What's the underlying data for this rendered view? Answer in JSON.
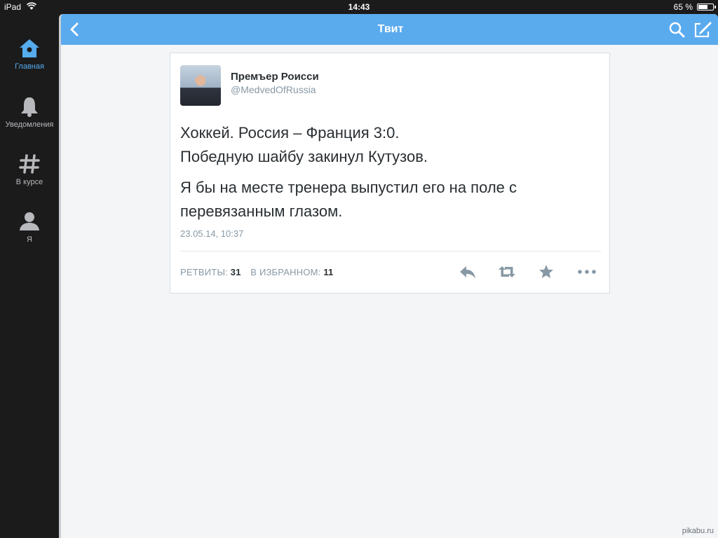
{
  "status_bar": {
    "device": "iPad",
    "time": "14:43",
    "battery": "65 %",
    "battery_level": 0.65
  },
  "sidebar": {
    "items": [
      {
        "label": "Главная",
        "icon": "home-icon",
        "active": true
      },
      {
        "label": "Уведомления",
        "icon": "bell-icon",
        "active": false
      },
      {
        "label": "В курсе",
        "icon": "hashtag-icon",
        "active": false
      },
      {
        "label": "Я",
        "icon": "person-icon",
        "active": false
      }
    ]
  },
  "navbar": {
    "title": "Твит",
    "icons": [
      "back-icon",
      "search-icon",
      "compose-icon"
    ],
    "color": "#5aaaee"
  },
  "tweet": {
    "author_name": "Премъер Роисси",
    "author_handle": "@MedvedOfRussia",
    "text_line1": "Хоккей. Россия – Франция 3:0.",
    "text_line2": "Победную шайбу закинул Кутузов.",
    "text_para2": "Я бы на месте тренера выпустил его на поле с перевязанным глазом.",
    "timestamp": "23.05.14, 10:37",
    "retweets_label": "РЕТВИТЫ:",
    "retweets_count": "31",
    "favorites_label": "В ИЗБРАННОМ:",
    "favorites_count": "11",
    "actions": [
      "reply-icon",
      "retweet-icon",
      "favorite-icon",
      "more-icon"
    ]
  },
  "watermark": "pikabu.ru"
}
